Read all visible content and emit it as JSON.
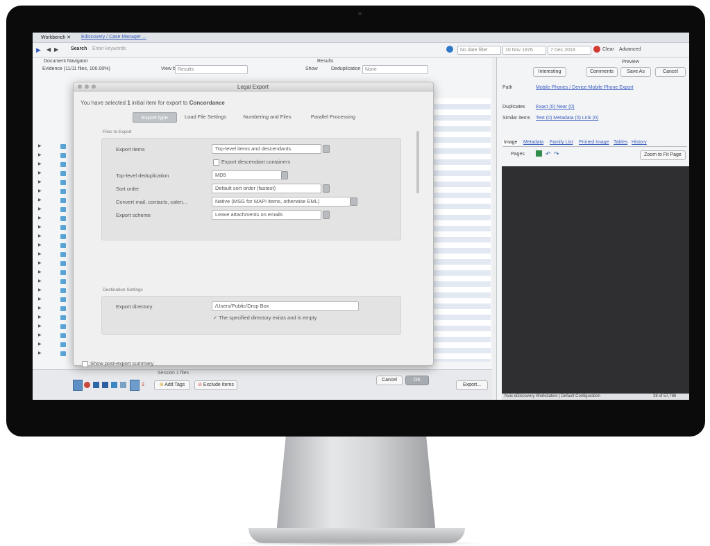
{
  "app": {
    "tab_title": "Workbench ✕",
    "tab_path": "Ediscovery / Case Manager ..."
  },
  "toolbar": {
    "search_label": "Search",
    "search_placeholder": "Enter keywords",
    "date_filter": "No date filter",
    "date_from": "10 Nov 1976",
    "date_to": "7 Dec 2018",
    "clear_label": "Clear",
    "advanced_label": "Advanced"
  },
  "left_pane": {
    "document_navigator": "Document Navigator",
    "results_header": "Results",
    "evidence_row": "Evidence (11/11 files, 100.00%)",
    "view_by_label": "View by",
    "view_by_value": "Results",
    "deduplication_label": "Deduplication",
    "deduplication_value": "None",
    "show_label": "Show"
  },
  "dialog": {
    "title": "Legal Export",
    "intro_prefix": "You have selected",
    "intro_count": "1",
    "intro_mid": "initial item for export to",
    "intro_target": "Concordance",
    "tabs": [
      "Export type",
      "Load File Settings",
      "Numbering and Files",
      "Parallel Processing"
    ],
    "items_section": "Files to Export",
    "export_items_label": "Export items",
    "export_items_value": "Top-level items and descendants",
    "export_descendant_label": "Export descendant containers",
    "dedup_label": "Top-level deduplication",
    "dedup_value": "MD5",
    "sort_label": "Sort order",
    "sort_value": "Default sort order (fastest)",
    "convert_label": "Convert mail, contacts, calen...",
    "convert_value": "Native (MSG for MAPI items, otherwise EML)",
    "attachments_label": "Export scheme",
    "attachments_value": "Leave attachments on emails",
    "dest_section": "Destination Settings",
    "dest_label": "Export directory",
    "dest_value": "/Users/Public/Drop Box",
    "dest_status": "✓ The specified directory exists and is empty",
    "summary_label": "Show post-export summary",
    "cancel_label": "Cancel",
    "ok_label": "OK"
  },
  "preview": {
    "title": "Preview",
    "interesting_label": "Interesting",
    "comments_label": "Comments",
    "save_as_label": "Save As",
    "cancel_label": "Cancel",
    "path_label": "Path",
    "path_value": "Mobile Phones / Device Mobile Phone Export",
    "duplicates_label": "Duplicates",
    "duplicates_value": "Exact (0) Near (0)",
    "similar_label": "Similar items",
    "similar_value": "Text (0) Metadata (0) Link (0)",
    "tabs": [
      "Image",
      "Metadata",
      "Family List",
      "Printed Image",
      "Tables",
      "History"
    ],
    "pages_label": "Pages",
    "fit_label": "Zoom to Fit Page",
    "status_text": "Nuix eDiscovery Workstation | Default Configuration",
    "status_count": "38 of 57,786"
  },
  "bottom": {
    "add_tags_label": "Add Tags",
    "exclude_label": "Exclude Items",
    "export_label": "Export...",
    "history_label": "Session 1 files"
  }
}
